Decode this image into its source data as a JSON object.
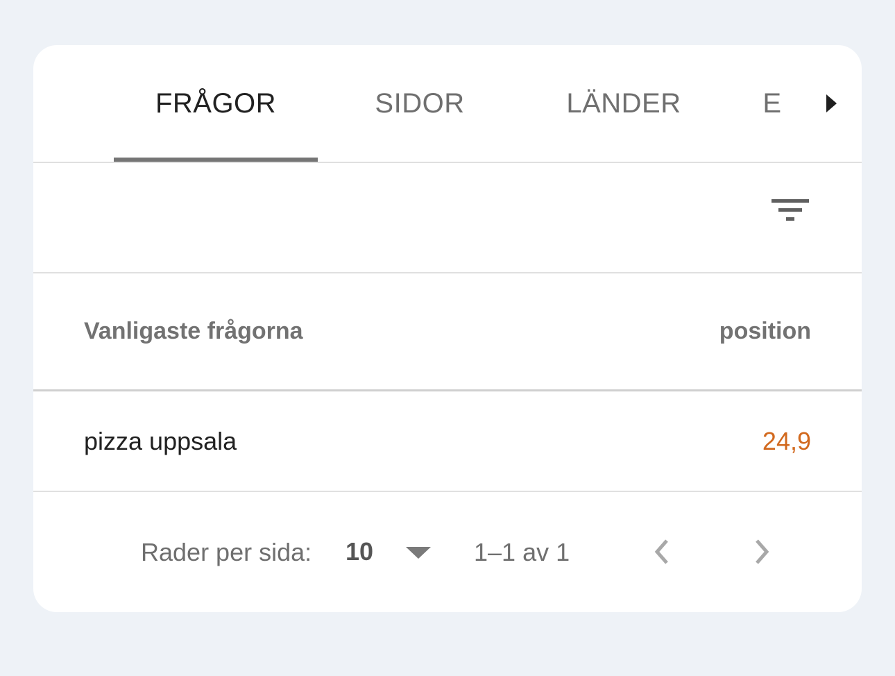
{
  "tabs": [
    {
      "label": "FRÅGOR",
      "active": true
    },
    {
      "label": "SIDOR",
      "active": false
    },
    {
      "label": "LÄNDER",
      "active": false
    },
    {
      "label": "E",
      "active": false
    }
  ],
  "table": {
    "columns": [
      "Vanligaste frågorna",
      "position"
    ],
    "rows": [
      {
        "query": "pizza uppsala",
        "position": "24,9"
      }
    ]
  },
  "pagination": {
    "rows_label": "Rader per sida:",
    "rows_value": "10",
    "range": "1–1 av 1"
  },
  "colors": {
    "background": "#eef2f7",
    "position_value": "#d2691e",
    "tab_indicator": "#757575"
  },
  "icons": [
    "chevron-right-icon",
    "filter-icon",
    "dropdown-caret-icon",
    "chevron-left-icon",
    "chevron-right-icon"
  ]
}
